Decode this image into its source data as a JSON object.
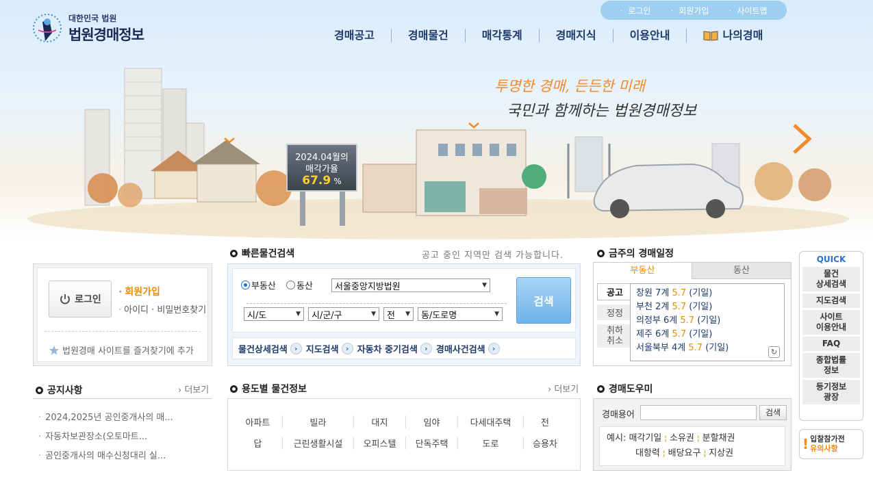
{
  "header": {
    "logo_sub": "대한민국 법원",
    "logo_main": "법원경매정보",
    "util_links": [
      "로그인",
      "회원가입",
      "사이트맵"
    ],
    "nav": [
      "경매공고",
      "경매물건",
      "매각통계",
      "경매지식",
      "이용안내",
      "나의경매"
    ]
  },
  "hero": {
    "slogan1": "투명한 경매, 든든한 미래",
    "slogan2": "국민과 함께하는 법원경매정보",
    "billboard_line1": "2024.04월의",
    "billboard_line2": "매각가율",
    "billboard_rate": "67.9",
    "billboard_unit": "%"
  },
  "login": {
    "button": "로그인",
    "join": "회원가입",
    "find": "아이디 · 비밀번호찾기",
    "favorite": "법원경매 사이트를 즐겨찾기에 추가"
  },
  "quick_search": {
    "title": "빠른물건검색",
    "note": "공고 중인 지역만 검색 가능합니다.",
    "radio_realestate": "부동산",
    "radio_movable": "동산",
    "court": "서울중앙지방법원",
    "sido": "시/도",
    "sigungu": "시/군/구",
    "jeon": "전",
    "dong": "동/도로명",
    "search_button": "검색",
    "links": [
      "물건상세검색",
      "지도검색",
      "자동차 중기검색",
      "경매사건검색"
    ]
  },
  "schedule": {
    "title": "금주의 경매일정",
    "tab_active": "부동산",
    "tab_inactive": "동산",
    "side_tags": [
      "공고",
      "정정",
      "취하\n취소"
    ],
    "rows": [
      {
        "court": "창원 7계",
        "date": "5.7",
        "status": "(기일)"
      },
      {
        "court": "부천 2계",
        "date": "5.7",
        "status": "(기일)"
      },
      {
        "court": "의정부 6계",
        "date": "5.7",
        "status": "(기일)"
      },
      {
        "court": "제주 6계",
        "date": "5.7",
        "status": "(기일)"
      },
      {
        "court": "서울북부 4계",
        "date": "5.7",
        "status": "(기일)"
      }
    ]
  },
  "quick_menu": {
    "title": "QUICK",
    "items": [
      "물건\n상세검색",
      "지도검색",
      "사이트\n이용안내",
      "FAQ",
      "종합법률\n정보",
      "등기정보\n광장"
    ],
    "caution_line1": "입찰참가전",
    "caution_line2": "유의사항"
  },
  "notices": {
    "title": "공지사항",
    "more": "더보기",
    "items": [
      "2024,2025년 공인중개사의 매...",
      "자동차보관장소(오토마트...",
      "공인중개사의 매수신청대리 실..."
    ]
  },
  "category": {
    "title": "용도별 물건정보",
    "more": "더보기",
    "row1": [
      "아파트",
      "빌라",
      "대지",
      "임야",
      "다세대주택",
      "전"
    ],
    "row2": [
      "답",
      "근린생활시설",
      "오피스텔",
      "단독주택",
      "도로",
      "승용차"
    ]
  },
  "glossary": {
    "title": "경매도우미",
    "label": "경매용어",
    "input_value": "",
    "button": "검색",
    "example_label": "예시:",
    "terms_row1": [
      "매각기일",
      "소유권",
      "분할채권"
    ],
    "terms_row2": [
      "대항력",
      "배당요구",
      "지상권"
    ]
  }
}
